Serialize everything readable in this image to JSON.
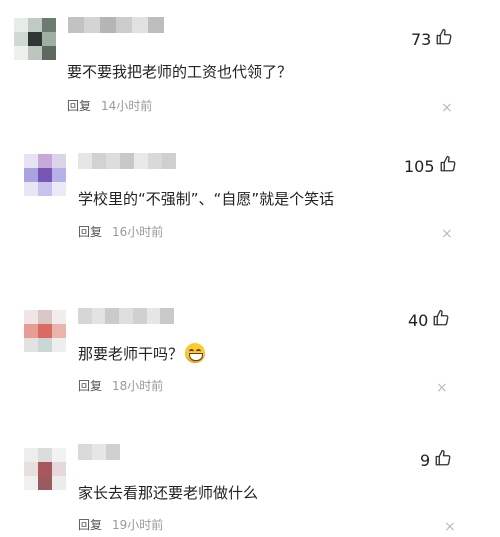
{
  "comments": [
    {
      "likes": "73",
      "text": "要不要我把老师的工资也代领了？",
      "reply_label": "回复",
      "time": "14小时前",
      "emoji": false,
      "close_icon": "close-icon",
      "like_icon": "thumbs-up-icon",
      "avatar_colors": [
        "#e6ece7",
        "#bfcac2",
        "#6c7b70",
        "#cfd8d1",
        "#2e3731",
        "#9fb0a3",
        "#edf1ee",
        "#bcc6be",
        "#5d6a60"
      ],
      "name_colors": [
        "#c2c2c2",
        "#d4d4d4",
        "#b5b5b5",
        "#cccccc",
        "#e1e1e1",
        "#bdbdbd"
      ]
    },
    {
      "likes": "105",
      "text": "学校里的“不强制”、“自愿”就是个笑话",
      "reply_label": "回复",
      "time": "16小时前",
      "emoji": false,
      "close_icon": "close-icon",
      "like_icon": "thumbs-up-icon",
      "avatar_colors": [
        "#e9e2f0",
        "#c5a9d9",
        "#dcd3e6",
        "#a9a4e0",
        "#7a55b8",
        "#b7b1ea",
        "#e8e5f5",
        "#c9c2ec",
        "#eceaf7"
      ],
      "name_colors": [
        "#e6e6e6",
        "#d2d2d2",
        "#dddddd",
        "#c8c8c8",
        "#e9e9e9",
        "#d9d9d9",
        "#cfcfcf"
      ]
    },
    {
      "likes": "40",
      "text": "那要老师干吗？",
      "reply_label": "回复",
      "time": "18小时前",
      "emoji": true,
      "close_icon": "close-icon",
      "like_icon": "thumbs-up-icon",
      "avatar_colors": [
        "#efe5e5",
        "#d9c7c7",
        "#f2eded",
        "#e79d96",
        "#d96b63",
        "#eab3ad",
        "#e2e2e2",
        "#cdd6d6",
        "#eeeeee"
      ],
      "name_colors": [
        "#d6d6d6",
        "#e3e3e3",
        "#cacaca",
        "#dedede",
        "#d0d0d0",
        "#e6e6e6",
        "#c9c9c9"
      ]
    },
    {
      "likes": "9",
      "text": "家长去看那还要老师做什么",
      "reply_label": "回复",
      "time": "19小时前",
      "emoji": false,
      "close_icon": "close-icon",
      "like_icon": "thumbs-up-icon",
      "avatar_colors": [
        "#eeeeee",
        "#dcdcdc",
        "#f2f2f2",
        "#e7dede",
        "#a8585c",
        "#e5d8d8",
        "#f0f0f0",
        "#9b5a5e",
        "#ececec"
      ],
      "name_colors": [
        "#dadada",
        "#e6e6e6",
        "#d0d0d0"
      ]
    }
  ]
}
